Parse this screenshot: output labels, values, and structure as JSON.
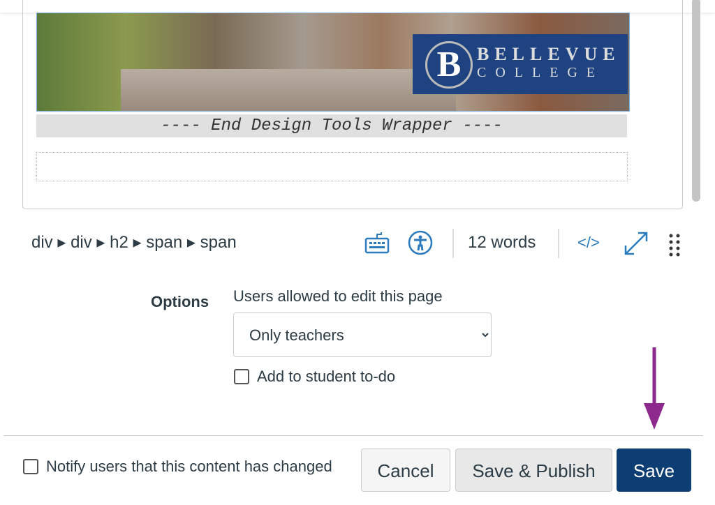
{
  "editor": {
    "end_wrapper_text": "---- End Design Tools Wrapper ----",
    "logo_text": {
      "initial": "B",
      "line1": "BELLEVUE",
      "line2": "COLLEGE"
    }
  },
  "statusbar": {
    "path": "div ▸ div ▸ h2 ▸ span ▸ span",
    "word_count": "12 words",
    "html_toggle": "</>"
  },
  "options": {
    "heading": "Options",
    "edit_label": "Users allowed to edit this page",
    "edit_value": "Only teachers",
    "todo_label": "Add to student to-do"
  },
  "footer": {
    "notify_label": "Notify users that this content has changed",
    "cancel": "Cancel",
    "save_publish": "Save & Publish",
    "save": "Save"
  },
  "annotation": {
    "arrow_color": "#8e2a8e"
  }
}
